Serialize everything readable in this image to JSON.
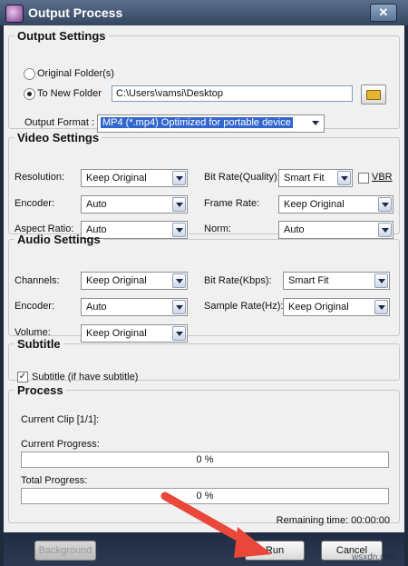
{
  "window": {
    "title": "Output Process",
    "close_label": "✕"
  },
  "output_settings": {
    "legend": "Output Settings",
    "original_folder_label": "Original Folder(s)",
    "to_new_folder_label": "To New Folder",
    "folder_path": "C:\\Users\\vamsi\\Desktop",
    "output_format_label": "Output Format :",
    "output_format_value": "MP4  (*.mp4) Optimized for portable device"
  },
  "video_settings": {
    "legend": "Video Settings",
    "resolution_label": "Resolution:",
    "resolution_value": "Keep Original",
    "encoder_label": "Encoder:",
    "encoder_value": "Auto",
    "aspect_label": "Aspect Ratio:",
    "aspect_value": "Auto",
    "bitrate_label": "Bit Rate(Quality):",
    "bitrate_value": "Smart Fit",
    "vbr_label": "VBR",
    "framerate_label": "Frame Rate:",
    "framerate_value": "Keep Original",
    "norm_label": "Norm:",
    "norm_value": "Auto"
  },
  "audio_settings": {
    "legend": "Audio Settings",
    "channels_label": "Channels:",
    "channels_value": "Keep Original",
    "encoder_label": "Encoder:",
    "encoder_value": "Auto",
    "volume_label": "Volume:",
    "volume_value": "Keep Original",
    "bitrate_label": "Bit Rate(Kbps):",
    "bitrate_value": "Smart Fit",
    "samplerate_label": "Sample Rate(Hz):",
    "samplerate_value": "Keep Original"
  },
  "subtitle": {
    "legend": "Subtitle",
    "checkbox_label": "Subtitle (if have subtitle)",
    "checked_mark": "✓"
  },
  "process": {
    "legend": "Process",
    "current_clip": "Current Clip [1/1]:",
    "current_progress_label": "Current Progress:",
    "current_progress_value": "0 %",
    "total_progress_label": "Total Progress:",
    "total_progress_value": "0 %",
    "remaining_time": "Remaining time: 00:00:00"
  },
  "buttons": {
    "background": "Background",
    "run": "Run",
    "cancel": "Cancel"
  },
  "watermark": "wsxdn.com",
  "colors": {
    "title_bar": "#34465f",
    "selection": "#3366cc",
    "arrow": "#e8473a"
  }
}
